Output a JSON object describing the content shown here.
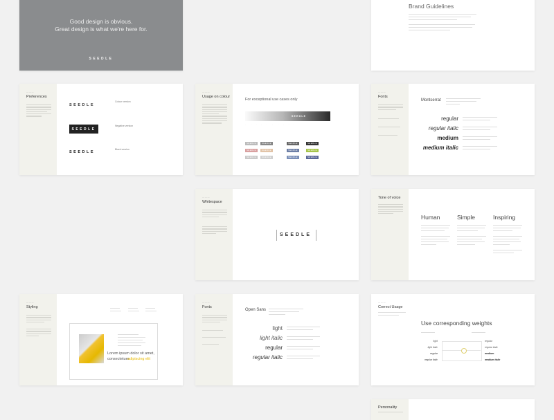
{
  "hero": {
    "line1": "Good design is obvious.",
    "line2": "Great design is what we're here for.",
    "logo": "SEEDLE"
  },
  "brand": {
    "title": "Brand Guidelines"
  },
  "preferences": {
    "title": "Preferences",
    "variants": [
      {
        "logo": "SEEDLE",
        "label": "Colour version"
      },
      {
        "logo": "SEEDLE",
        "label": "Negative version"
      },
      {
        "logo": "SEEDLE",
        "label": "Black version"
      }
    ]
  },
  "colour": {
    "title": "Usage on colour",
    "heading": "For exceptional use cases only",
    "logo": "SEEDLE",
    "chips": [
      "SEEDLE",
      "SEEDLE",
      "SEEDLE",
      "SEEDLE",
      "SEEDLE",
      "SEEDLE",
      "SEEDLE",
      "SEEDLE",
      "SEEDLE",
      "SEEDLE",
      "SEEDLE",
      "SEEDLE"
    ]
  },
  "fonts1": {
    "title": "Fonts",
    "family": "Montserrat",
    "weights": [
      "regular",
      "regular italic",
      "medium",
      "medium italic"
    ]
  },
  "whitespace": {
    "title": "Whitespace",
    "logo": "SEEDLE"
  },
  "tone": {
    "title": "Tone of voice",
    "words": [
      "Human",
      "Simple",
      "Inspiring"
    ]
  },
  "styling": {
    "title": "Styling",
    "quote1": "Lorem ipsum dolor sit amet,",
    "quote2": "consectetuer",
    "quote3": "adipiscing elit"
  },
  "fonts2": {
    "title": "Fonts",
    "family": "Open Sans",
    "weights": [
      "light",
      "light italic",
      "regular",
      "regular italic"
    ]
  },
  "correct": {
    "title": "Correct Usage",
    "heading": "Use corresponding weights",
    "left": [
      "light",
      "light italic",
      "regular",
      "regular italic"
    ],
    "right": [
      "regular",
      "regular italic",
      "medium",
      "medium italic"
    ]
  },
  "personality": {
    "title": "Personality"
  }
}
